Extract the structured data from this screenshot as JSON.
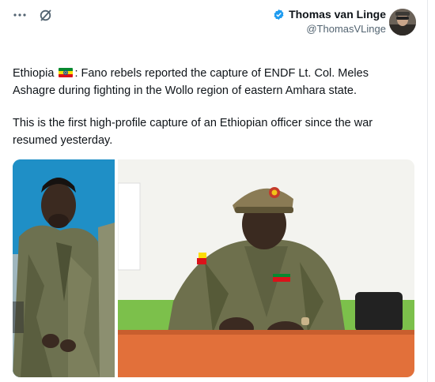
{
  "header": {
    "more_icon": "ellipsis-icon",
    "grok_icon": "slash-circle-icon"
  },
  "author": {
    "name": "Thomas van Linge",
    "handle": "@ThomasVLinge",
    "verified_color": "#1d9bf0"
  },
  "tweet": {
    "para1_before_flag": "Ethiopia",
    "para1_after_flag": ": Fano rebels reported the capture of ENDF Lt. Col. Meles Ashagre during fighting in the Wollo region of eastern Amhara state.",
    "para2": "This is the first high-profile capture of an Ethiopian officer since the war resumed yesterday."
  },
  "colors": {
    "text": "#0f1419",
    "secondary": "#536471",
    "accent": "#1d9bf0"
  }
}
